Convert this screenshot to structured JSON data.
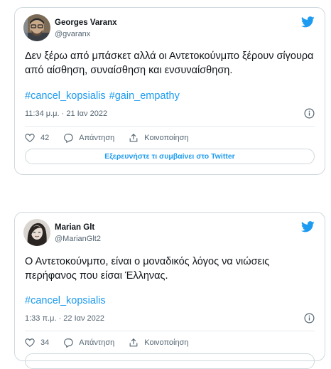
{
  "tweets": [
    {
      "author_name": "Georges Varanx",
      "author_handle": "@gvaranx",
      "text": "Δεν ξέρω από μπάσκετ αλλά οι Αντετοκούνμπο ξέρουν σίγουρα από αίσθηση, συναίσθηση και ενσυναίσθηση.",
      "hashtags": [
        "#cancel_kopsialis",
        "#gain_empathy"
      ],
      "timestamp": "11:34 μ.μ. · 21 Ιαν 2022",
      "likes": "42",
      "reply_label": "Απάντηση",
      "share_label": "Κοινοποίηση",
      "explore_label": "Εξερευνήστε τι συμβαίνει στο Twitter"
    },
    {
      "author_name": "Marian Glt",
      "author_handle": "@MarianGlt2",
      "text": "Ο Αντετοκούνμπο, είναι ο μοναδικός λόγος να νιώσεις περήφανος που είσαι Έλληνας.",
      "hashtags": [
        "#cancel_kopsialis"
      ],
      "timestamp": "1:33 π.μ. · 22 Ιαν 2022",
      "likes": "34",
      "reply_label": "Απάντηση",
      "share_label": "Κοινοποίηση"
    }
  ],
  "icons": {
    "brand": "twitter-bird-icon",
    "info": "info-icon",
    "like": "heart-icon",
    "reply": "speech-bubble-icon",
    "share": "share-icon"
  },
  "colors": {
    "accent": "#1d9bf0",
    "text": "#0f1419",
    "muted": "#536471",
    "border": "#cfd9de"
  }
}
